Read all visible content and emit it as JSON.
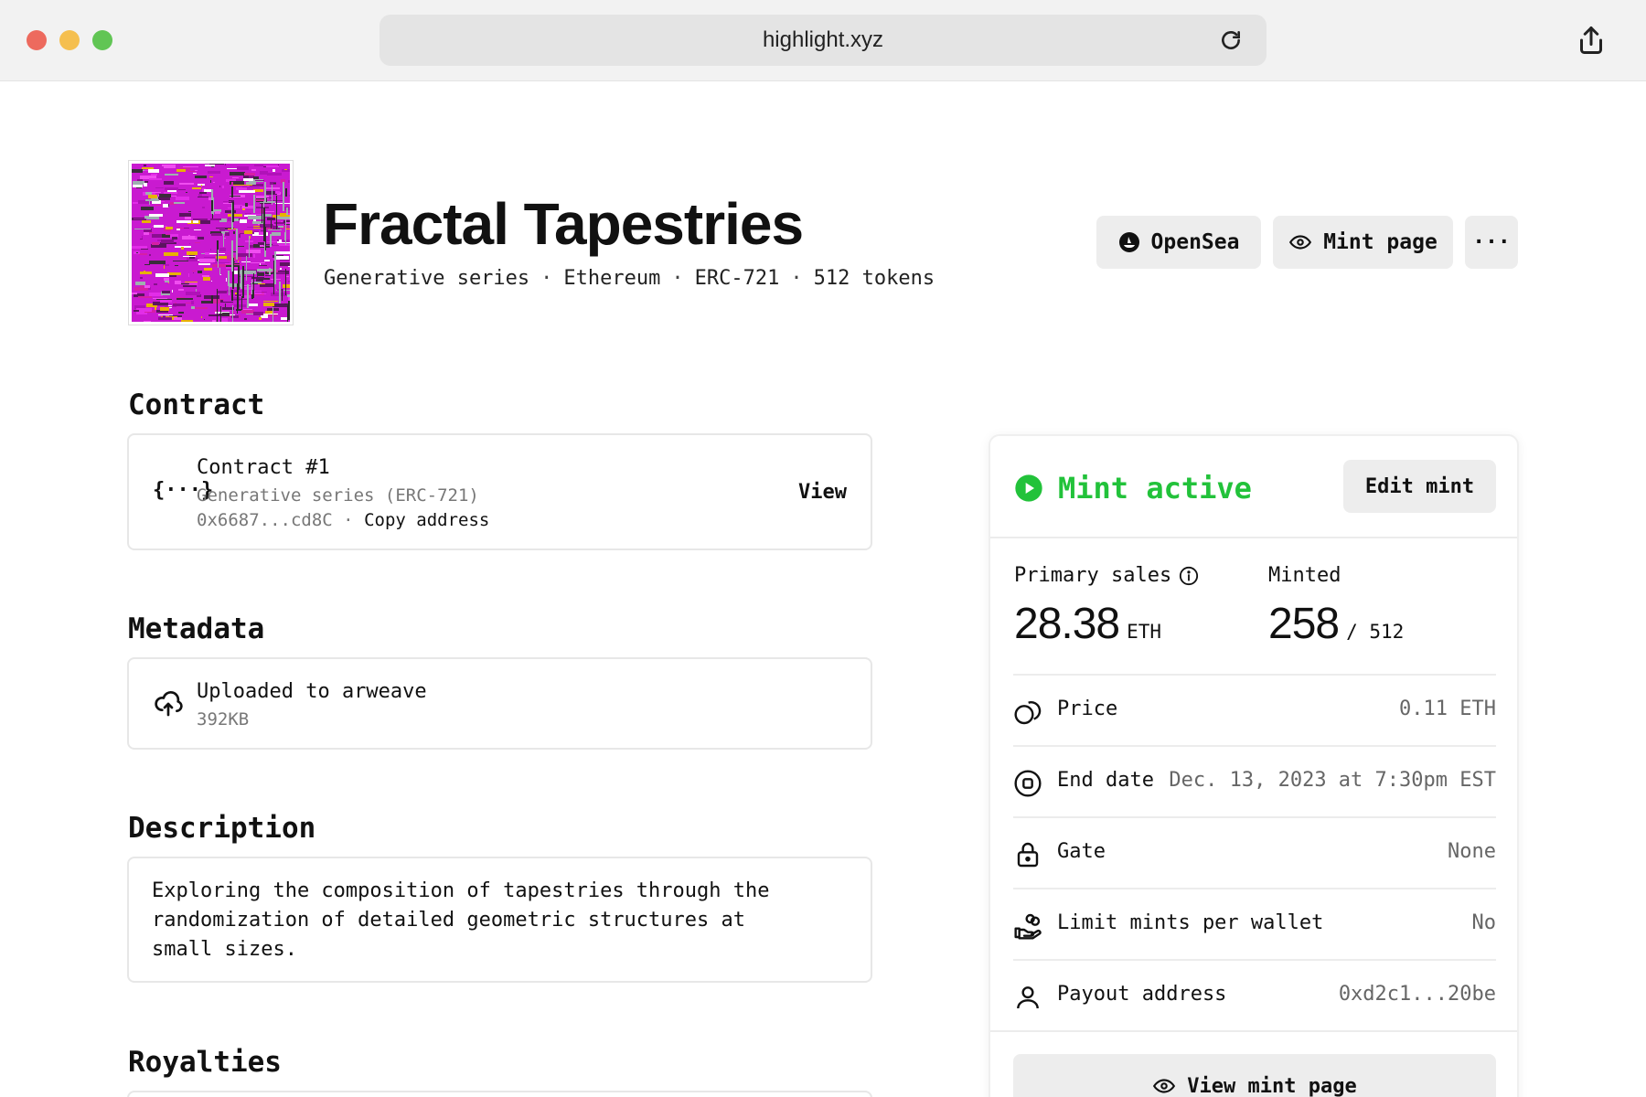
{
  "browser": {
    "url": "highlight.xyz"
  },
  "collection": {
    "title": "Fractal Tapestries",
    "meta": [
      "Generative series",
      "Ethereum",
      "ERC-721",
      "512 tokens"
    ],
    "meta_separator": "·"
  },
  "header_actions": {
    "opensea_label": "OpenSea",
    "mint_page_label": "Mint page",
    "more_label": "···"
  },
  "sections": {
    "contract": {
      "title": "Contract",
      "icon_text": "{···}",
      "name": "Contract #1",
      "subtitle": "Generative series (ERC-721)",
      "address": "0x6687...cd8C",
      "separator": "·",
      "copy_label": "Copy address",
      "view_label": "View"
    },
    "metadata": {
      "title": "Metadata",
      "name": "Uploaded to arweave",
      "size": "392KB"
    },
    "description": {
      "title": "Description",
      "text": "Exploring the composition of tapestries through the randomization of detailed geometric structures at small sizes."
    },
    "royalties": {
      "title": "Royalties"
    }
  },
  "mint_panel": {
    "status": "Mint active",
    "edit_label": "Edit mint",
    "primary_sales_label": "Primary sales",
    "primary_sales_value": "28.38",
    "primary_sales_unit": "ETH",
    "minted_label": "Minted",
    "minted_value": "258",
    "minted_total": "/ 512",
    "rows": [
      {
        "label": "Price",
        "value": "0.11 ETH",
        "icon": "coins-icon"
      },
      {
        "label": "End date",
        "value": "Dec. 13, 2023 at 7:30pm EST",
        "icon": "stop-circle-icon"
      },
      {
        "label": "Gate",
        "value": "None",
        "icon": "lock-icon"
      },
      {
        "label": "Limit mints per wallet",
        "value": "No",
        "icon": "hand-coins-icon"
      },
      {
        "label": "Payout address",
        "value": "0xd2c1...20be",
        "icon": "user-icon"
      }
    ],
    "view_mint_label": "View mint page"
  },
  "colors": {
    "accent_green": "#22c23a",
    "button_bg": "#ededed",
    "thumb_magenta": "#c91ad0"
  }
}
